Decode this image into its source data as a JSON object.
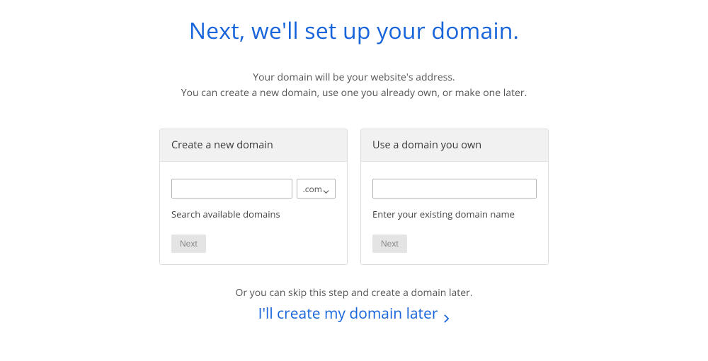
{
  "title": "Next, we'll set up your domain.",
  "subtitle": {
    "line1": "Your domain will be your website's address.",
    "line2": "You can create a new domain, use one you already own, or make one later."
  },
  "create": {
    "heading": "Create a new domain",
    "tld": ".com",
    "help": "Search available domains",
    "button": "Next"
  },
  "own": {
    "heading": "Use a domain you own",
    "help": "Enter your existing domain name",
    "button": "Next"
  },
  "skip": {
    "note": "Or you can skip this step and create a domain later.",
    "link": "I'll create my domain later"
  }
}
